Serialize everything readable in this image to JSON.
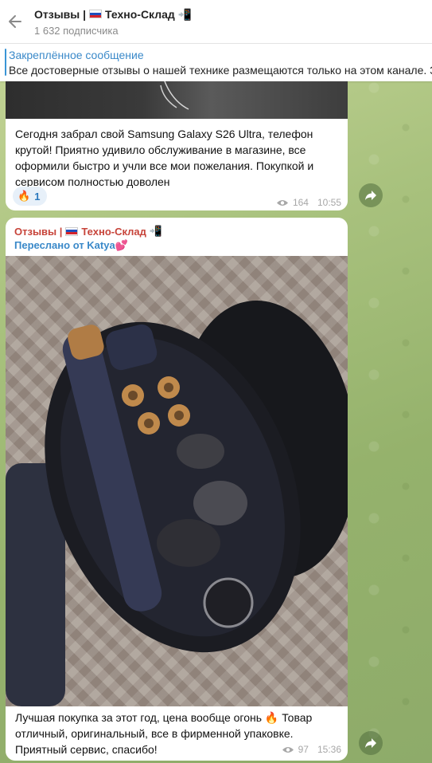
{
  "header": {
    "title": "Отзывы | ",
    "title_emoji": "📲",
    "channel_name": "Техно-Склад",
    "subscribers": "1 632 подписчика"
  },
  "pinned": {
    "title": "Закреплённое сообщение",
    "text": "Все достоверные отзывы о нашей технике размещаются только на этом канале.  Здесь"
  },
  "messages": [
    {
      "text": "Сегодня забрал свой Samsung Galaxy S26 Ultra, телефон крутой! Приятно удивило обслуживание в магазине, все оформили быстро и учли все мои пожелания. Покупкой и сервисом полностью доволен",
      "reaction_emoji": "🔥",
      "reaction_count": "1",
      "views": "164",
      "time": "10:55"
    },
    {
      "forward_title": "Отзывы | ",
      "forward_channel": "Техно-Склад",
      "forward_emoji": "📲",
      "forwarded_from": "Переслано от Katya💕",
      "text": "Лучшая покупка за этот год, цена вообще огонь 🔥 Товар отличный, оригинальный, все в фирменной упаковке. Приятный сервис, спасибо!",
      "views": "97",
      "time": "15:36"
    }
  ],
  "colors": {
    "accent": "#3a89c9",
    "forward_title": "#c7443a",
    "header_bg": "#ffffff",
    "chat_bg": "#a9c27e"
  },
  "icons": [
    "back-arrow-icon",
    "flag-ru-icon",
    "phone-arrow-icon",
    "eye-icon",
    "share-icon",
    "fire-icon"
  ]
}
